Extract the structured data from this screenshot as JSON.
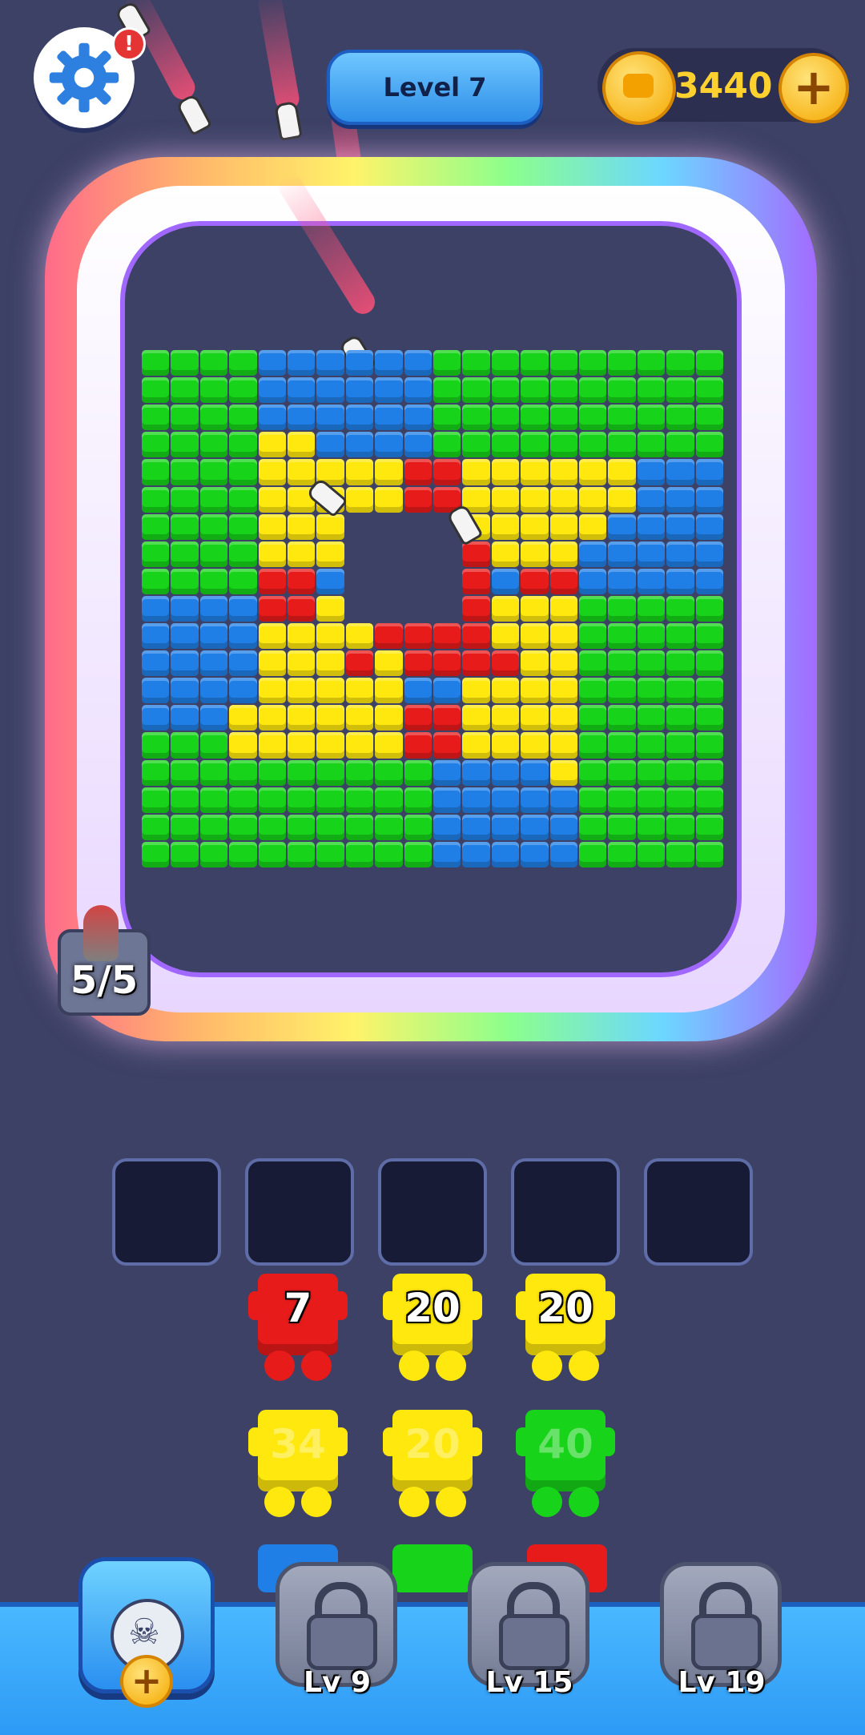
{
  "header": {
    "settings_icon": "gear-icon",
    "notification_badge": "!",
    "level_label": "Level 7",
    "coins": "3440",
    "coin_add_label": "+"
  },
  "board": {
    "colors": {
      "G": "#17d319",
      "B": "#1f7fe6",
      "Y": "#ffe80d",
      "R": "#e81b1b"
    },
    "ammo_label": "5/5",
    "rows": [
      "GGGGBBBBBBGGGGGGGGGG",
      "GGGGBBBBBBGGGGGGGGGG",
      "GGGGBBBBBBGGGGGGGGGG",
      "GGGGYYBBBBGGGGGGGGGG",
      "GGGGYYYYYRRYYYYYYBBB",
      "GGGGYYYYYRRYYYYYYBBB",
      "GGGGYYY....YYYYYBBBB",
      "GGGGYYY....RYYYBBBBB",
      "GGGGRRB....RBRRBBBBB",
      "BBBBRRY....RYYYGGGGG",
      "BBBBYYYYRRRRYYYGGGGG",
      "BBBBYYYRYRRRRYYGGGGG",
      "BBBBYYYYYBBYYYYGGGGG",
      "BBBYYYYYYRRYYYYGGGGG",
      "GGGYYYYYYRRYYYYGGGGG",
      "GGGGGGGGGGBBBBYGGGGG",
      "GGGGGGGGGGBBBBBGGGGG",
      "GGGGGGGGGGBBBBBGGGGG",
      "GGGGGGGGGGBBBBBGGGGG"
    ]
  },
  "slots": {
    "count": 5
  },
  "shooters": [
    {
      "value": "7",
      "color": "#e81b1b",
      "active": true
    },
    {
      "value": "20",
      "color": "#ffe80d",
      "active": true
    },
    {
      "value": "20",
      "color": "#ffe80d",
      "active": true
    },
    {
      "value": "34",
      "color": "#ffe80d",
      "active": false
    },
    {
      "value": "20",
      "color": "#ffe80d",
      "active": false
    },
    {
      "value": "40",
      "color": "#17d319",
      "active": false
    }
  ],
  "powerups": {
    "bomb_icon": "bomb-skull-icon",
    "bomb_add_label": "+",
    "locked": [
      {
        "label": "Lv 9",
        "icon": "lock-icon"
      },
      {
        "label": "Lv 15",
        "icon": "lock-icon"
      },
      {
        "label": "Lv 19",
        "icon": "lock-icon"
      }
    ]
  }
}
